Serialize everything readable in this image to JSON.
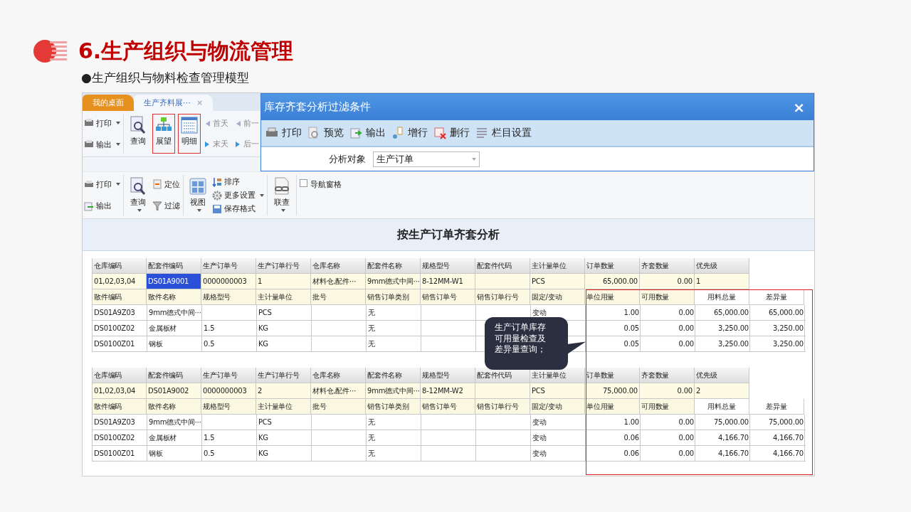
{
  "slide": {
    "title": "6.生产组织与物流管理",
    "subtitle": "●生产组织与物料检查管理模型"
  },
  "back_window": {
    "tabs": [
      {
        "label": "我的桌面",
        "selected": false
      },
      {
        "label": "生产齐料展⋯",
        "selected": true,
        "close": "×"
      }
    ],
    "small_tools": [
      {
        "label": "打印",
        "dropdown": true
      },
      {
        "label": "输出",
        "dropdown": true
      }
    ],
    "large_tools": [
      {
        "label": "查询",
        "highlighted": false
      },
      {
        "label": "展望",
        "highlighted": true
      },
      {
        "label": "明细",
        "highlighted": true
      }
    ],
    "nav": [
      "首天",
      "前一",
      "末天",
      "后一"
    ]
  },
  "dialog": {
    "title": "库存齐套分析过滤条件",
    "close": "×",
    "toolbar": [
      "打印",
      "预览",
      "输出",
      "增行",
      "删行",
      "栏目设置"
    ],
    "field_label": "分析对象",
    "field_value": "生产订单"
  },
  "ribbon": {
    "tools": [
      {
        "label": "打印",
        "dropdown": true
      },
      {
        "label": "输出",
        "dropdown": false
      },
      {
        "label": "查询",
        "dropdown": true
      },
      {
        "label": "定位",
        "dropdown": false
      },
      {
        "label": "过滤",
        "dropdown": false
      },
      {
        "label": "视图",
        "dropdown": true
      },
      {
        "label": "排序",
        "dropdown": false
      },
      {
        "label": "更多设置",
        "dropdown": true
      },
      {
        "label": "保存格式",
        "dropdown": false
      },
      {
        "label": "联查",
        "dropdown": true
      }
    ],
    "nav_pane": {
      "label": "导航窗格",
      "checked": false
    }
  },
  "report": {
    "title": "按生产订单齐套分析",
    "blocks": [
      {
        "header_columns": [
          "仓库编码",
          "配套件编码",
          "生产订单号",
          "生产订单行号",
          "仓库名称",
          "配套件名称",
          "规格型号",
          "配套件代码",
          "主计量单位",
          "订单数量",
          "齐套数量",
          "优先级"
        ],
        "header_values": [
          {
            "text": "01,02,03,04",
            "selected": false
          },
          {
            "text": "DS01A9001",
            "selected": true
          },
          {
            "text": "0000000003",
            "selected": false
          },
          {
            "text": "1",
            "selected": false
          },
          {
            "text": "材料仓,配件⋯",
            "selected": false
          },
          {
            "text": "9mm德式中间⋯",
            "selected": false
          },
          {
            "text": "8-12MM-W1",
            "selected": false
          },
          {
            "selected": false
          },
          {
            "text": "PCS",
            "selected": false
          },
          {
            "text": "65,000.00",
            "selected": false
          },
          {
            "text": "0.00",
            "selected": false
          },
          {
            "text": "1",
            "selected": false
          }
        ],
        "detail_columns": [
          "散件编码",
          "散件名称",
          "规格型号",
          "主计量单位",
          "批号",
          "销售订单类别",
          "销售订单号",
          "销售订单行号",
          "固定/变动",
          "单位用量",
          "可用数量",
          "用料总量",
          "差异量"
        ],
        "rows": [
          [
            "DS01A9Z03",
            "9mm德式中间⋯",
            "",
            "PCS",
            "",
            "无",
            "",
            "",
            "变动",
            "1.00",
            "0.00",
            "65,000.00",
            "65,000.00"
          ],
          [
            "DS0100Z02",
            "金属板材",
            "1.5",
            "KG",
            "",
            "无",
            "",
            "",
            "",
            "0.05",
            "0.00",
            "3,250.00",
            "3,250.00"
          ],
          [
            "DS0100Z01",
            "钢板",
            "0.5",
            "KG",
            "",
            "无",
            "",
            "",
            "",
            "0.05",
            "0.00",
            "3,250.00",
            "3,250.00"
          ]
        ]
      },
      {
        "header_columns": [
          "仓库编码",
          "配套件编码",
          "生产订单号",
          "生产订单行号",
          "仓库名称",
          "配套件名称",
          "规格型号",
          "配套件代码",
          "主计量单位",
          "订单数量",
          "齐套数量",
          "优先级"
        ],
        "header_values": [
          {
            "text": "01,02,03,04",
            "selected": false
          },
          {
            "text": "DS01A9002",
            "selected": false
          },
          {
            "text": "0000000003",
            "selected": false
          },
          {
            "text": "2",
            "selected": false
          },
          {
            "text": "材料仓,配件⋯",
            "selected": false
          },
          {
            "text": "9mm德式中间⋯",
            "selected": false
          },
          {
            "text": "8-12MM-W2",
            "selected": false
          },
          {
            "selected": false
          },
          {
            "text": "PCS",
            "selected": false
          },
          {
            "text": "75,000.00",
            "selected": false
          },
          {
            "text": "0.00",
            "selected": false
          },
          {
            "text": "2",
            "selected": false
          }
        ],
        "detail_columns": [
          "散件编码",
          "散件名称",
          "规格型号",
          "主计量单位",
          "批号",
          "销售订单类别",
          "销售订单号",
          "销售订单行号",
          "固定/变动",
          "单位用量",
          "可用数量",
          "用料总量",
          "差异量"
        ],
        "rows": [
          [
            "DS01A9Z03",
            "9mm德式中间⋯",
            "",
            "PCS",
            "",
            "无",
            "",
            "",
            "变动",
            "1.00",
            "0.00",
            "75,000.00",
            "75,000.00"
          ],
          [
            "DS0100Z02",
            "金属板材",
            "1.5",
            "KG",
            "",
            "无",
            "",
            "",
            "变动",
            "0.06",
            "0.00",
            "4,166.70",
            "4,166.70"
          ],
          [
            "DS0100Z01",
            "钢板",
            "0.5",
            "KG",
            "",
            "无",
            "",
            "",
            "变动",
            "0.06",
            "0.00",
            "4,166.70",
            "4,166.70"
          ]
        ]
      }
    ]
  },
  "callout": {
    "text": "生产订单库存可用量检查及差异量查询；"
  }
}
